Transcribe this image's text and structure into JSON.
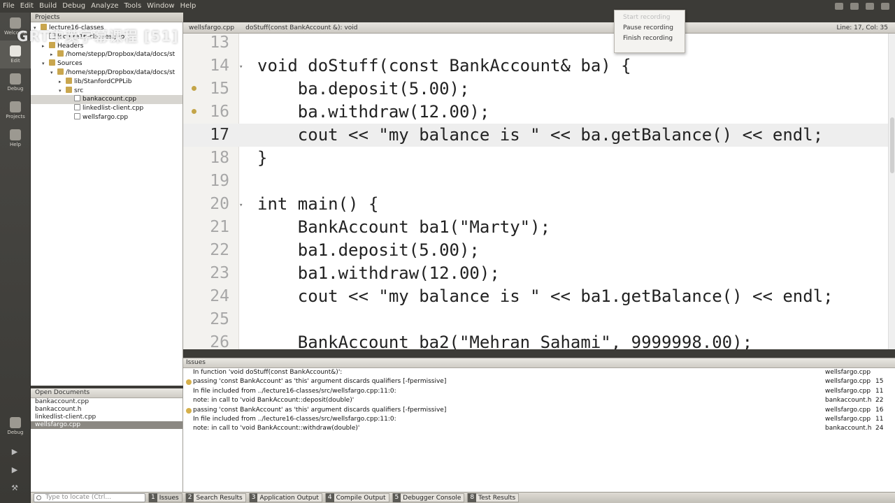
{
  "menubar": {
    "items": [
      "File",
      "Edit",
      "Build",
      "Debug",
      "Analyze",
      "Tools",
      "Window",
      "Help"
    ]
  },
  "watermark": "GRT中英字幕课程 [51]",
  "recording_menu": {
    "items": [
      {
        "label": "Start recording",
        "enabled": false
      },
      {
        "label": "Pause recording",
        "enabled": true
      },
      {
        "label": "Finish recording",
        "enabled": true
      }
    ]
  },
  "modes": [
    {
      "label": "Welcome",
      "icon": "welcome-icon"
    },
    {
      "label": "Edit",
      "icon": "edit-icon",
      "active": true
    },
    {
      "label": "Debug",
      "icon": "debug-icon"
    },
    {
      "label": "Projects",
      "icon": "projects-icon"
    },
    {
      "label": "Help",
      "icon": "help-icon"
    }
  ],
  "run_target": {
    "label": "Debug"
  },
  "projects": {
    "header": "Projects",
    "tree": [
      {
        "label": "lecture16-classes",
        "indent": 0,
        "type": "project",
        "arrow": "▾"
      },
      {
        "label": "lecture16-classes.pro",
        "indent": 1,
        "type": "file",
        "arrow": ""
      },
      {
        "label": "Headers",
        "indent": 1,
        "type": "folder",
        "arrow": "▸"
      },
      {
        "label": "/home/stepp/Dropbox/data/docs/st",
        "indent": 2,
        "type": "folder",
        "arrow": "▸"
      },
      {
        "label": "Sources",
        "indent": 1,
        "type": "folder",
        "arrow": "▾"
      },
      {
        "label": "/home/stepp/Dropbox/data/docs/st",
        "indent": 2,
        "type": "folder",
        "arrow": "▾"
      },
      {
        "label": "lib/StanfordCPPLib",
        "indent": 3,
        "type": "folder",
        "arrow": "▸"
      },
      {
        "label": "src",
        "indent": 3,
        "type": "folder",
        "arrow": "▾"
      },
      {
        "label": "bankaccount.cpp",
        "indent": 4,
        "type": "file",
        "arrow": "",
        "selected": true
      },
      {
        "label": "linkedlist-client.cpp",
        "indent": 4,
        "type": "file",
        "arrow": ""
      },
      {
        "label": "wellsfargo.cpp",
        "indent": 4,
        "type": "file",
        "arrow": ""
      }
    ]
  },
  "open_documents": {
    "header": "Open Documents",
    "items": [
      {
        "label": "bankaccount.cpp"
      },
      {
        "label": "bankaccount.h"
      },
      {
        "label": "linkedlist-client.cpp"
      },
      {
        "label": "wellsfargo.cpp",
        "selected": true
      }
    ]
  },
  "editor_toolbar": {
    "file": "wellsfargo.cpp",
    "symbol": "doStuff(const BankAccount &): void",
    "position": "Line: 17, Col: 35"
  },
  "code": {
    "current_line": 17,
    "lines": [
      {
        "n": "13",
        "text": ""
      },
      {
        "n": "14",
        "text": "void doStuff(const BankAccount& ba) {",
        "fold": true
      },
      {
        "n": "15",
        "text": "    ba.deposit(5.00);",
        "marker": true
      },
      {
        "n": "16",
        "text": "    ba.withdraw(12.00);",
        "marker": true
      },
      {
        "n": "17",
        "text": "    cout << \"my balance is \" << ba.getBalance() << endl;"
      },
      {
        "n": "18",
        "text": "}"
      },
      {
        "n": "19",
        "text": ""
      },
      {
        "n": "20",
        "text": "int main() {",
        "fold": true
      },
      {
        "n": "21",
        "text": "    BankAccount ba1(\"Marty\");"
      },
      {
        "n": "22",
        "text": "    ba1.deposit(5.00);"
      },
      {
        "n": "23",
        "text": "    ba1.withdraw(12.00);"
      },
      {
        "n": "24",
        "text": "    cout << \"my balance is \" << ba1.getBalance() << endl;"
      },
      {
        "n": "25",
        "text": ""
      },
      {
        "n": "26",
        "text": "    BankAccount ba2(\"Mehran Sahami\", 9999998.00);"
      }
    ]
  },
  "issues": {
    "header": "Issues",
    "rows": [
      {
        "msg": "In function 'void doStuff(const BankAccount&)':",
        "file": "wellsfargo.cpp",
        "line": "",
        "icon": false
      },
      {
        "msg": "passing 'const BankAccount' as 'this' argument discards qualifiers [-fpermissive]",
        "file": "wellsfargo.cpp",
        "line": "15",
        "icon": true
      },
      {
        "msg": "In file included from ../lecture16-classes/src/wellsfargo.cpp:11:0:",
        "file": "wellsfargo.cpp",
        "line": "11",
        "icon": false
      },
      {
        "msg": "note:   in call to 'void BankAccount::deposit(double)'",
        "file": "bankaccount.h",
        "line": "22",
        "icon": false
      },
      {
        "msg": "passing 'const BankAccount' as 'this' argument discards qualifiers [-fpermissive]",
        "file": "wellsfargo.cpp",
        "line": "16",
        "icon": true
      },
      {
        "msg": "In file included from ../lecture16-classes/src/wellsfargo.cpp:11:0:",
        "file": "wellsfargo.cpp",
        "line": "11",
        "icon": false
      },
      {
        "msg": "note:   in call to 'void BankAccount::withdraw(double)'",
        "file": "bankaccount.h",
        "line": "24",
        "icon": false
      }
    ]
  },
  "statusbar": {
    "locate_placeholder": "Type to locate (Ctrl...",
    "outputs": [
      {
        "num": "1",
        "label": "Issues",
        "active": true
      },
      {
        "num": "2",
        "label": "Search Results"
      },
      {
        "num": "3",
        "label": "Application Output"
      },
      {
        "num": "4",
        "label": "Compile Output"
      },
      {
        "num": "5",
        "label": "Debugger Console"
      },
      {
        "num": "8",
        "label": "Test Results"
      }
    ]
  }
}
